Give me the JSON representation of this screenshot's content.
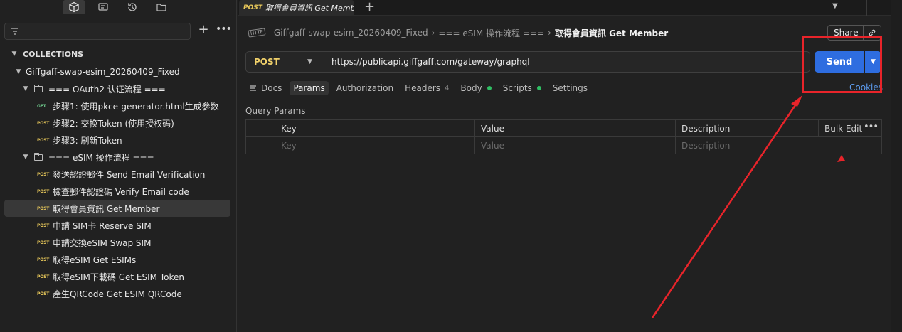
{
  "sidebar": {
    "collections_header": "COLLECTIONS",
    "collection_name": "Giffgaff-swap-esim_20260409_Fixed",
    "folders": [
      {
        "name": "=== OAuth2 认证流程 ===",
        "items": [
          {
            "method": "GET",
            "name": "步骤1: 使用pkce-generator.html生成参数"
          },
          {
            "method": "POST",
            "name": "步骤2: 交换Token (使用授权码)"
          },
          {
            "method": "POST",
            "name": "步骤3: 刷新Token"
          }
        ]
      },
      {
        "name": "=== eSIM 操作流程 ===",
        "items": [
          {
            "method": "POST",
            "name": "發送認證郵件 Send Email Verification"
          },
          {
            "method": "POST",
            "name": "檢查郵件認證碼 Verify Email code"
          },
          {
            "method": "POST",
            "name": "取得會員資訊 Get Member"
          },
          {
            "method": "POST",
            "name": "申請 SIM卡 Reserve SIM"
          },
          {
            "method": "POST",
            "name": "申請交換eSIM Swap SIM"
          },
          {
            "method": "POST",
            "name": "取得eSIM Get ESIMs"
          },
          {
            "method": "POST",
            "name": "取得eSIM下載碼 Get ESIM Token"
          },
          {
            "method": "POST",
            "name": "產生QRCode Get ESIM QRCode"
          }
        ]
      }
    ]
  },
  "tabs": [
    {
      "method": "POST",
      "title": "取得會員資訊 Get Member"
    }
  ],
  "breadcrumb": {
    "icon": "HTTP",
    "collection": "Giffgaff-swap-esim_20260409_Fixed",
    "folder": "=== eSIM 操作流程 ===",
    "current": "取得會員資訊 Get Member"
  },
  "share_label": "Share",
  "request": {
    "method": "POST",
    "url": "https://publicapi.giffgaff.com/gateway/graphql",
    "send_label": "Send",
    "cookies_label": "Cookies"
  },
  "req_tabs": {
    "docs": "Docs",
    "params": "Params",
    "authorization": "Authorization",
    "headers": "Headers",
    "headers_count": "4",
    "body": "Body",
    "scripts": "Scripts",
    "settings": "Settings"
  },
  "query_params": {
    "label": "Query Params",
    "columns": [
      "Key",
      "Value",
      "Description"
    ],
    "placeholders": [
      "Key",
      "Value",
      "Description"
    ],
    "bulk_edit": "Bulk Edit"
  },
  "colors": {
    "accent": "#2e6de0",
    "post": "#e8c85a",
    "get": "#6cc489",
    "annotation": "#e8242a",
    "status_dot": "#2fbe63"
  }
}
